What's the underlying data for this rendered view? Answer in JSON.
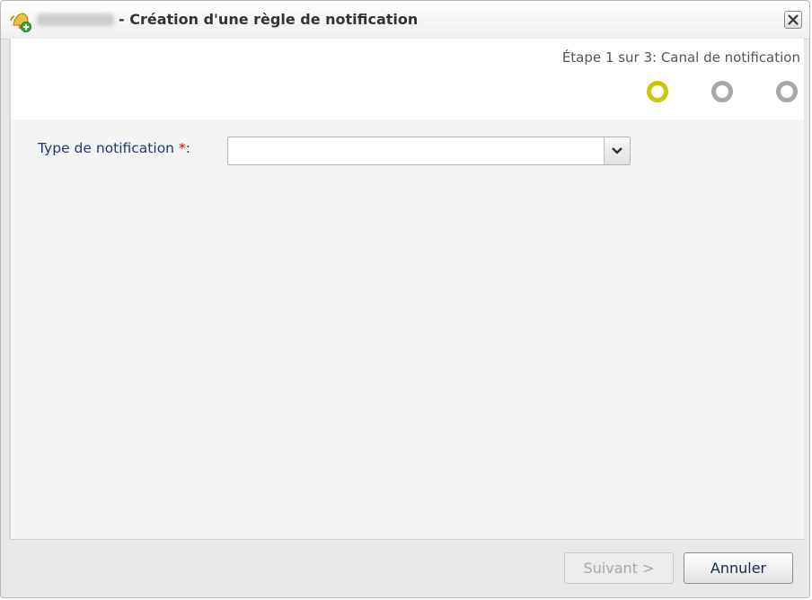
{
  "dialog": {
    "app_name_blurred": "Lyra SMS",
    "title": "- Création d'une règle de notification",
    "close_icon": "close-icon"
  },
  "wizard": {
    "step_label": "Étape 1 sur 3: Canal de notification",
    "current_step": 1,
    "total_steps": 3,
    "active_color": "#c8c800",
    "inactive_color": "#a8a8a8"
  },
  "form": {
    "type_label": "Type de notification",
    "required_marker": "*",
    "colon": ":",
    "type_value": ""
  },
  "footer": {
    "next_label": "Suivant >",
    "cancel_label": "Annuler"
  }
}
